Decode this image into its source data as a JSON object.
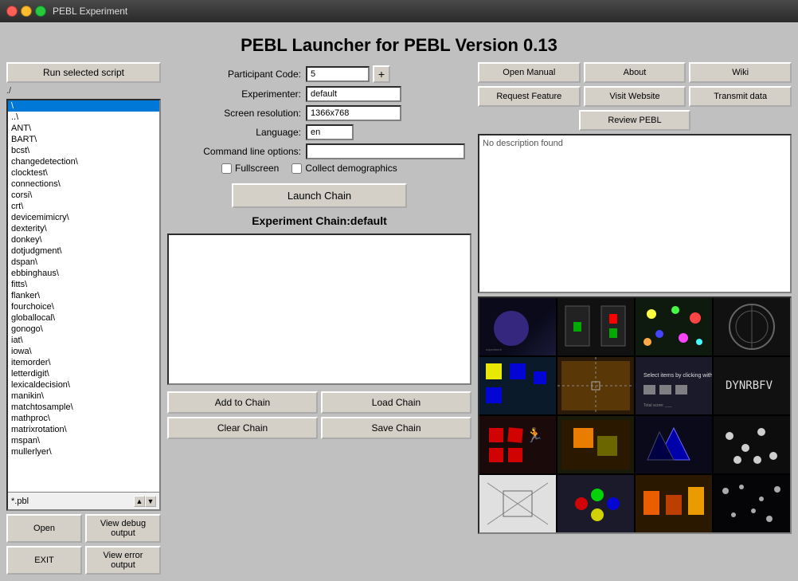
{
  "window": {
    "title": "PEBL Experiment"
  },
  "app": {
    "title": "PEBL Launcher for PEBL Version 0.13"
  },
  "left_panel": {
    "run_button": "Run selected script",
    "path": "./",
    "filter": "*.pbl",
    "files": [
      "\\",
      "..\\ ",
      "ANT\\",
      "BART\\",
      "bcst\\",
      "changedetection\\",
      "clocktest\\",
      "connections\\",
      "corsi\\",
      "crt\\",
      "devicemimicry\\",
      "dexterity\\",
      "donkey\\",
      "dotjudgment\\",
      "dspan\\",
      "ebbinghaus\\",
      "fitts\\",
      "flanker\\",
      "fourchoice\\",
      "globallocal\\",
      "gonogo\\",
      "iat\\",
      "iowa\\",
      "itemorder\\",
      "letterdigit\\",
      "lexicaldecision\\",
      "manikin\\",
      "matchtosample\\",
      "mathproc\\",
      "matrixrotation\\",
      "mspan\\",
      "mullerlyer\\"
    ],
    "open_button": "Open",
    "debug_button": "View debug output",
    "error_button": "View error output",
    "exit_button": "EXIT"
  },
  "form": {
    "participant_code_label": "Participant Code:",
    "participant_code_value": "5",
    "experimenter_label": "Experimenter:",
    "experimenter_value": "default",
    "screen_resolution_label": "Screen resolution:",
    "screen_resolution_value": "1366x768",
    "language_label": "Language:",
    "language_value": "en",
    "cmdline_label": "Command line options:",
    "cmdline_value": "",
    "fullscreen_label": "Fullscreen",
    "demographics_label": "Collect demographics",
    "launch_button": "Launch Chain",
    "chain_title": "Experiment Chain:default",
    "add_to_chain": "Add to Chain",
    "load_chain": "Load Chain",
    "clear_chain": "Clear Chain",
    "save_chain": "Save Chain"
  },
  "right_panel": {
    "open_manual": "Open Manual",
    "about": "About",
    "wiki": "Wiki",
    "request_feature": "Request Feature",
    "visit_website": "Visit Website",
    "transmit_data": "Transmit data",
    "review_pebl": "Review PEBL",
    "description": "No description found"
  }
}
